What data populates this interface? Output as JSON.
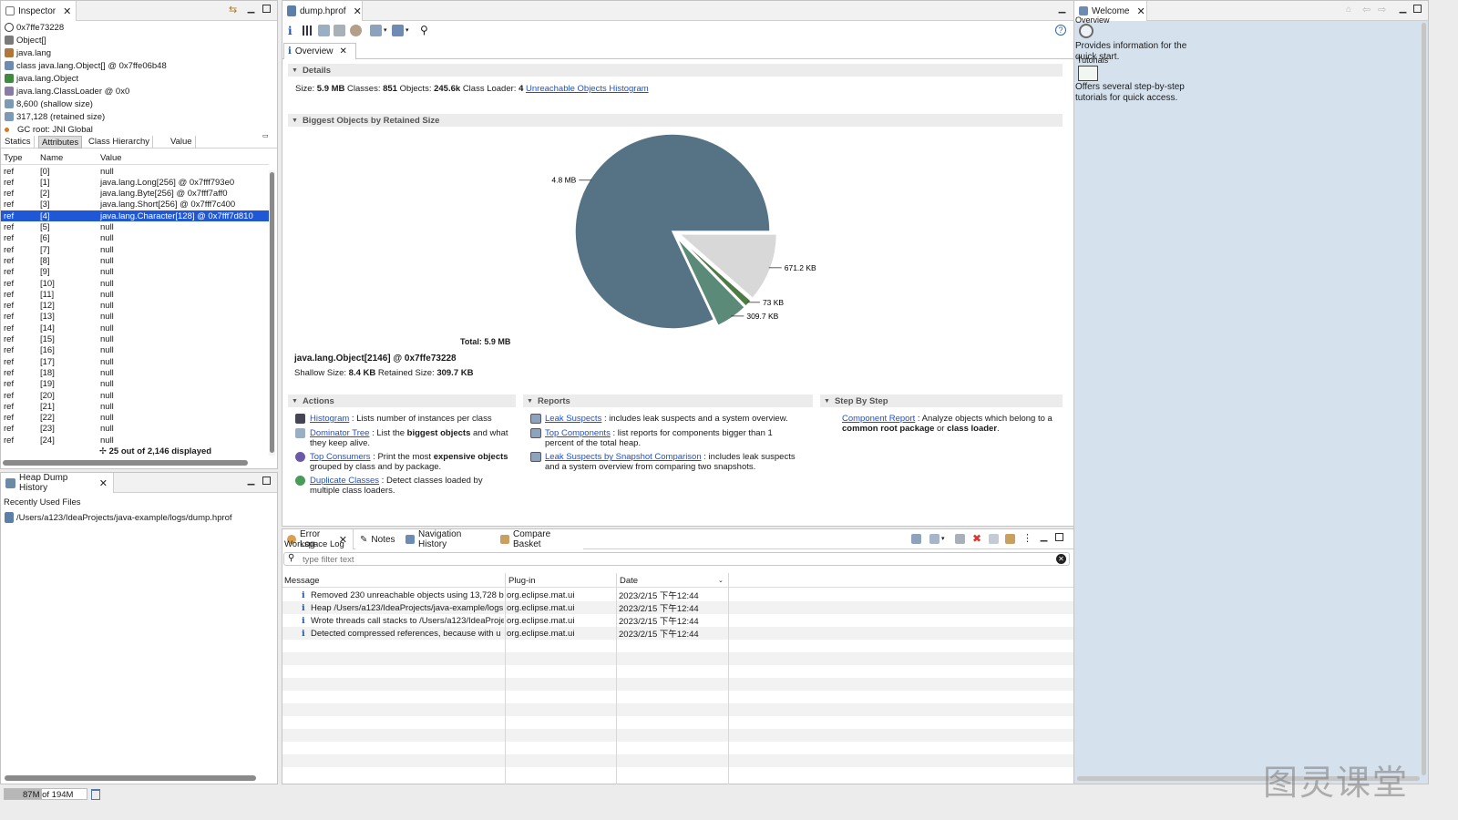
{
  "inspector": {
    "tab": "Inspector",
    "header_rows": [
      {
        "icon": "at-icon",
        "text": "0x7ffe73228"
      },
      {
        "icon": "array-icon",
        "text": "Object[]"
      },
      {
        "icon": "package-icon",
        "text": "java.lang"
      },
      {
        "icon": "class-icon",
        "text": "class java.lang.Object[] @ 0x7ffe06b48"
      },
      {
        "icon": "superclass-icon",
        "text": "java.lang.Object"
      },
      {
        "icon": "classloader-icon",
        "text": "java.lang.ClassLoader @ 0x0"
      },
      {
        "icon": "size-icon",
        "text": "8,600 (shallow size)"
      },
      {
        "icon": "size-icon",
        "text": "317,128 (retained size)"
      },
      {
        "icon": "gc-root-icon",
        "text": "GC root: JNI Global"
      }
    ],
    "subtabs": [
      "Statics",
      "Attributes",
      "Class Hierarchy",
      "Value"
    ],
    "active_subtab": 1,
    "columns": [
      "Type",
      "Name",
      "Value"
    ],
    "rows": [
      {
        "type": "ref",
        "name": "[0]",
        "value": "null"
      },
      {
        "type": "ref",
        "name": "[1]",
        "value": "java.lang.Long[256] @ 0x7fff793e0"
      },
      {
        "type": "ref",
        "name": "[2]",
        "value": "java.lang.Byte[256] @ 0x7fff7aff0"
      },
      {
        "type": "ref",
        "name": "[3]",
        "value": "java.lang.Short[256] @ 0x7fff7c400"
      },
      {
        "type": "ref",
        "name": "[4]",
        "value": "java.lang.Character[128] @ 0x7fff7d810"
      },
      {
        "type": "ref",
        "name": "[5]",
        "value": "null"
      },
      {
        "type": "ref",
        "name": "[6]",
        "value": "null"
      },
      {
        "type": "ref",
        "name": "[7]",
        "value": "null"
      },
      {
        "type": "ref",
        "name": "[8]",
        "value": "null"
      },
      {
        "type": "ref",
        "name": "[9]",
        "value": "null"
      },
      {
        "type": "ref",
        "name": "[10]",
        "value": "null"
      },
      {
        "type": "ref",
        "name": "[11]",
        "value": "null"
      },
      {
        "type": "ref",
        "name": "[12]",
        "value": "null"
      },
      {
        "type": "ref",
        "name": "[13]",
        "value": "null"
      },
      {
        "type": "ref",
        "name": "[14]",
        "value": "null"
      },
      {
        "type": "ref",
        "name": "[15]",
        "value": "null"
      },
      {
        "type": "ref",
        "name": "[16]",
        "value": "null"
      },
      {
        "type": "ref",
        "name": "[17]",
        "value": "null"
      },
      {
        "type": "ref",
        "name": "[18]",
        "value": "null"
      },
      {
        "type": "ref",
        "name": "[19]",
        "value": "null"
      },
      {
        "type": "ref",
        "name": "[20]",
        "value": "null"
      },
      {
        "type": "ref",
        "name": "[21]",
        "value": "null"
      },
      {
        "type": "ref",
        "name": "[22]",
        "value": "null"
      },
      {
        "type": "ref",
        "name": "[23]",
        "value": "null"
      },
      {
        "type": "ref",
        "name": "[24]",
        "value": "null"
      }
    ],
    "selected_row": 4,
    "footer": "25 out of 2,146 displayed"
  },
  "heap_history": {
    "tab": "Heap Dump History",
    "heading": "Recently Used Files",
    "file": "/Users/a123/IdeaProjects/java-example/logs/dump.hprof"
  },
  "status": {
    "memory": "87M of 194M",
    "memory_used_fraction": 0.45
  },
  "editor": {
    "tab": "dump.hprof",
    "subtab": "Overview",
    "details": {
      "title": "Details",
      "size_label": "Size:",
      "size": "5.9 MB",
      "classes_label": "Classes:",
      "classes": "851",
      "objects_label": "Objects:",
      "objects": "245.6k",
      "loader_label": "Class Loader:",
      "loader": "4",
      "histogram_link": "Unreachable Objects Histogram"
    },
    "biggest": {
      "title": "Biggest Objects by Retained Size",
      "total": "Total: 5.9 MB",
      "object": "java.lang.Object[2146] @ 0x7ffe73228",
      "shallow_label": "Shallow Size:",
      "shallow": "8.4 KB",
      "retained_label": "Retained Size:",
      "retained": "309.7 KB"
    },
    "actions": {
      "title": "Actions",
      "items": [
        {
          "icon": "histogram-icon",
          "link": "Histogram",
          "pre": " : Lists number of instances per class",
          "bold": "",
          "post": ""
        },
        {
          "icon": "dominator-tree-icon",
          "link": "Dominator Tree",
          "pre": " : List the ",
          "bold": "biggest objects",
          "post": " and what they keep alive."
        },
        {
          "icon": "top-consumers-icon",
          "link": "Top Consumers",
          "pre": " : Print the most ",
          "bold": "expensive objects",
          "post": " grouped by class and by package."
        },
        {
          "icon": "duplicate-classes-icon",
          "link": "Duplicate Classes",
          "pre": " : Detect classes loaded by multiple class loaders.",
          "bold": "",
          "post": ""
        }
      ]
    },
    "reports": {
      "title": "Reports",
      "items": [
        {
          "icon": "report-icon",
          "link": "Leak Suspects",
          "text": " : includes leak suspects and a system overview."
        },
        {
          "icon": "report-icon",
          "link": "Top Components",
          "text": " : list reports for components bigger than 1 percent of the total heap."
        },
        {
          "icon": "report-icon",
          "link": "Leak Suspects by Snapshot Comparison",
          "text": " : includes leak suspects and a system overview from comparing two snapshots."
        }
      ]
    },
    "step": {
      "title": "Step By Step",
      "link": "Component Report",
      "pre": " : Analyze objects which belong to a ",
      "bold1": "common root package",
      "mid": " or ",
      "bold2": "class loader",
      "post": "."
    }
  },
  "chart_data": {
    "type": "pie",
    "title": "",
    "unit": "MB",
    "slices": [
      {
        "label": "4.8 MB",
        "value": 4.8,
        "color": "#557385"
      },
      {
        "label": "309.7 KB",
        "value": 0.3097,
        "color": "#5b8a78"
      },
      {
        "label": "73 KB",
        "value": 0.073,
        "color": "#4e7a45"
      },
      {
        "label": "671.2 KB",
        "value": 0.6712,
        "color": "#d8d8d8"
      }
    ],
    "total": "Total: 5.9 MB"
  },
  "log": {
    "tabs": [
      "Error Log",
      "Notes",
      "Navigation History",
      "Compare Basket"
    ],
    "workspace": "Workspace Log",
    "filter_placeholder": "type filter text",
    "columns": [
      "Message",
      "Plug-in",
      "Date"
    ],
    "rows": [
      {
        "message": "Removed 230 unreachable objects using 13,728 b",
        "plugin": "org.eclipse.mat.ui",
        "date": "2023/2/15 下午12:44"
      },
      {
        "message": "Heap /Users/a123/IdeaProjects/java-example/logs",
        "plugin": "org.eclipse.mat.ui",
        "date": "2023/2/15 下午12:44"
      },
      {
        "message": "Wrote threads call stacks to /Users/a123/IdeaProje",
        "plugin": "org.eclipse.mat.ui",
        "date": "2023/2/15 下午12:44"
      },
      {
        "message": "Detected compressed references, because with u",
        "plugin": "org.eclipse.mat.ui",
        "date": "2023/2/15 下午12:44"
      }
    ]
  },
  "welcome": {
    "tab": "Welcome",
    "overview_title": "Overview",
    "overview_text": "Provides information for the quick start.",
    "tutorials_title": "Tutorials",
    "tutorials_text": "Offers several step-by-step tutorials for quick access."
  },
  "watermark": "图灵课堂"
}
